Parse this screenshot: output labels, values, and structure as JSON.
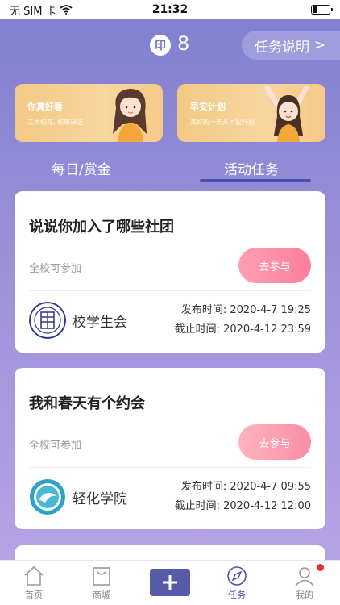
{
  "status_bar": {
    "carrier": "无 SIM 卡",
    "time": "21:32",
    "battery_level": 0.3
  },
  "header": {
    "stamp_glyph": "印",
    "stamp_count": "8",
    "task_desc": "任务说明",
    "task_desc_arrow": ">"
  },
  "banners": [
    {
      "title": "你真好看",
      "subtitle": "工大校花, 校草评选"
    },
    {
      "title": "早安计划",
      "subtitle": "美好的一天从早起开始"
    }
  ],
  "tabs": {
    "daily": "每日/赏金",
    "active": "活动任务"
  },
  "cards": [
    {
      "title": "说说你加入了哪些社团",
      "scope": "全校可参加",
      "join_label": "去参与",
      "org": "校学生会",
      "publish": "发布时间: 2020-4-7 19:25",
      "deadline": "截止时间: 2020-4-12 23:59"
    },
    {
      "title": "我和春天有个约会",
      "scope": "全校可参加",
      "join_label": "去参与",
      "org": "轻化学院",
      "publish": "发布时间: 2020-4-7 09:55",
      "deadline": "截止时间: 2020-4-12 12:00"
    }
  ],
  "tabbar": {
    "home": "首页",
    "shop": "商城",
    "task": "任务",
    "mine": "我的"
  },
  "colors": {
    "accent": "#4b4fb0",
    "button_pink": "#fb7f9a",
    "banner": "#f3c983",
    "badge": "#e5322d"
  }
}
